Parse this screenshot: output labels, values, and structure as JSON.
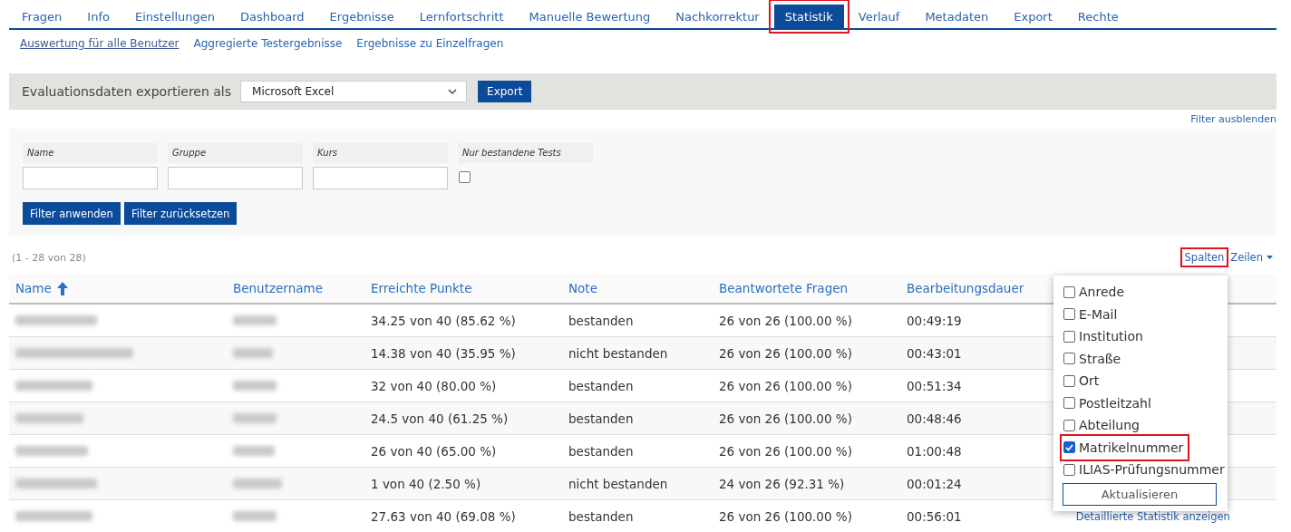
{
  "tabs": [
    {
      "label": "Fragen",
      "selected": false,
      "highlighted": false
    },
    {
      "label": "Info",
      "selected": false,
      "highlighted": false
    },
    {
      "label": "Einstellungen",
      "selected": false,
      "highlighted": false
    },
    {
      "label": "Dashboard",
      "selected": false,
      "highlighted": false
    },
    {
      "label": "Ergebnisse",
      "selected": false,
      "highlighted": false
    },
    {
      "label": "Lernfortschritt",
      "selected": false,
      "highlighted": false
    },
    {
      "label": "Manuelle Bewertung",
      "selected": false,
      "highlighted": false
    },
    {
      "label": "Nachkorrektur",
      "selected": false,
      "highlighted": false
    },
    {
      "label": "Statistik",
      "selected": true,
      "highlighted": true
    },
    {
      "label": "Verlauf",
      "selected": false,
      "highlighted": false
    },
    {
      "label": "Metadaten",
      "selected": false,
      "highlighted": false
    },
    {
      "label": "Export",
      "selected": false,
      "highlighted": false
    },
    {
      "label": "Rechte",
      "selected": false,
      "highlighted": false
    }
  ],
  "subtabs": [
    {
      "label": "Auswertung für alle Benutzer",
      "selected": true
    },
    {
      "label": "Aggregierte Testergebnisse",
      "selected": false
    },
    {
      "label": "Ergebnisse zu Einzelfragen",
      "selected": false
    }
  ],
  "export": {
    "label": "Evaluationsdaten exportieren als",
    "format": "Microsoft Excel",
    "button": "Export"
  },
  "filter_toggle": "Filter ausblenden",
  "filters": [
    {
      "kind": "text",
      "label": "Name"
    },
    {
      "kind": "text",
      "label": "Gruppe"
    },
    {
      "kind": "text",
      "label": "Kurs"
    },
    {
      "kind": "checkbox",
      "label": "Nur bestandene Tests",
      "checked": false
    }
  ],
  "filter_buttons": [
    "Filter anwenden",
    "Filter zurücksetzen"
  ],
  "table": {
    "count": "(1 - 28 von 28)",
    "columns_button": {
      "label": "Spalten",
      "highlighted": true
    },
    "rows_button": "Zeilen",
    "columns": [
      {
        "label": "Name",
        "sorted": true
      },
      {
        "label": "Benutzername",
        "sorted": false
      },
      {
        "label": "Erreichte Punkte",
        "sorted": false
      },
      {
        "label": "Note",
        "sorted": false
      },
      {
        "label": "Beantwortete Fragen",
        "sorted": false
      },
      {
        "label": "Bearbeitungsdauer",
        "sorted": false
      }
    ],
    "rows": [
      {
        "points": "34.25 von 40 (85.62 %)",
        "grade": "bestanden",
        "answered": "26 von 26 (100.00 %)",
        "duration": "00:49:19"
      },
      {
        "points": "14.38 von 40 (35.95 %)",
        "grade": "nicht bestanden",
        "answered": "26 von 26 (100.00 %)",
        "duration": "00:43:01"
      },
      {
        "points": "32 von 40 (80.00 %)",
        "grade": "bestanden",
        "answered": "26 von 26 (100.00 %)",
        "duration": "00:51:34"
      },
      {
        "points": "24.5 von 40 (61.25 %)",
        "grade": "bestanden",
        "answered": "26 von 26 (100.00 %)",
        "duration": "00:48:46"
      },
      {
        "points": "26 von 40 (65.00 %)",
        "grade": "bestanden",
        "answered": "26 von 26 (100.00 %)",
        "duration": "01:00:48"
      },
      {
        "points": "1 von 40 (2.50 %)",
        "grade": "nicht bestanden",
        "answered": "24 von 26 (92.31 %)",
        "duration": "00:01:24"
      },
      {
        "points": "27.63 von 40 (69.08 %)",
        "grade": "bestanden",
        "answered": "26 von 26 (100.00 %)",
        "duration": "00:56:01",
        "action": "Detaillierte Statistik anzeigen"
      }
    ]
  },
  "column_menu": {
    "options": [
      {
        "label": "Anrede",
        "checked": false,
        "highlighted": false
      },
      {
        "label": "E-Mail",
        "checked": false,
        "highlighted": false
      },
      {
        "label": "Institution",
        "checked": false,
        "highlighted": false
      },
      {
        "label": "Straße",
        "checked": false,
        "highlighted": false
      },
      {
        "label": "Ort",
        "checked": false,
        "highlighted": false
      },
      {
        "label": "Postleitzahl",
        "checked": false,
        "highlighted": false
      },
      {
        "label": "Abteilung",
        "checked": false,
        "highlighted": false
      },
      {
        "label": "Matrikelnummer",
        "checked": true,
        "highlighted": true
      },
      {
        "label": "ILIAS-Prüfungsnummer",
        "checked": false,
        "highlighted": false
      }
    ],
    "button": "Aktualisieren"
  }
}
